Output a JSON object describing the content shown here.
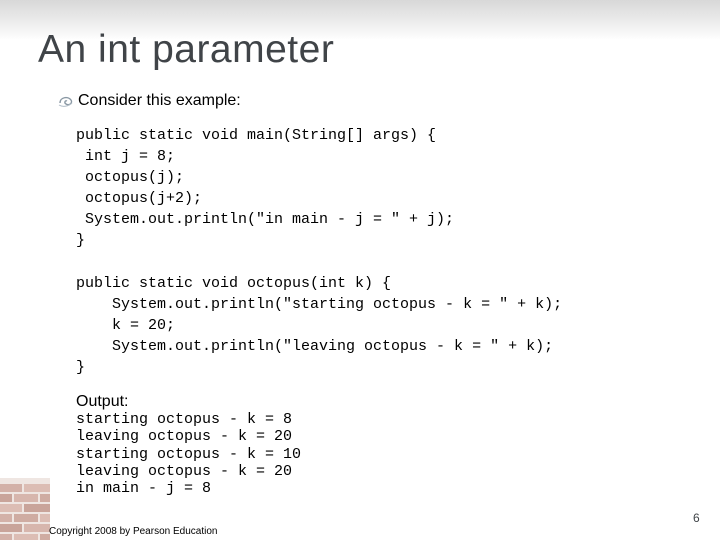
{
  "slide": {
    "title": "An int parameter",
    "bullet": "Consider this example:",
    "code_main": "public static void main(String[] args) {\n int j = 8;\n octopus(j);\n octopus(j+2);\n System.out.println(\"in main - j = \" + j);\n}",
    "code_octopus": "public static void octopus(int k) {\n    System.out.println(\"starting octopus - k = \" + k);\n    k = 20;\n    System.out.println(\"leaving octopus - k = \" + k);\n}",
    "output_label": "Output:",
    "output_text": "starting octopus - k = 8\nleaving octopus - k = 20\nstarting octopus - k = 10\nleaving octopus - k = 20\nin main - j = 8",
    "copyright": "Copyright 2008 by Pearson Education",
    "page_number": "6"
  },
  "icons": {
    "bullet": "bullet-swirl-icon",
    "corner": "brick-wall-decoration"
  },
  "colors": {
    "title": "#404448",
    "bullet": "#8a98a4",
    "brick": "#c9a49a"
  }
}
